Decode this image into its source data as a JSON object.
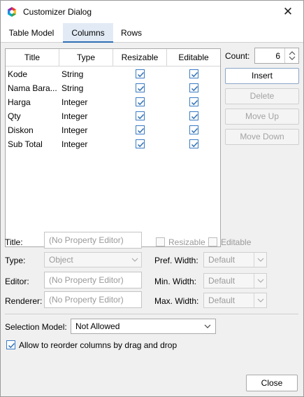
{
  "window": {
    "title": "Customizer Dialog",
    "close_glyph": "✕"
  },
  "tabs": [
    {
      "label": "Table Model",
      "active": false
    },
    {
      "label": "Columns",
      "active": true
    },
    {
      "label": "Rows",
      "active": false
    }
  ],
  "table": {
    "headers": [
      "Title",
      "Type",
      "Resizable",
      "Editable"
    ],
    "rows": [
      {
        "title": "Kode",
        "type": "String",
        "resizable": true,
        "editable": true
      },
      {
        "title": "Nama Bara...",
        "type": "String",
        "resizable": true,
        "editable": true
      },
      {
        "title": "Harga",
        "type": "Integer",
        "resizable": true,
        "editable": true
      },
      {
        "title": "Qty",
        "type": "Integer",
        "resizable": true,
        "editable": true
      },
      {
        "title": "Diskon",
        "type": "Integer",
        "resizable": true,
        "editable": true
      },
      {
        "title": "Sub Total",
        "type": "Integer",
        "resizable": true,
        "editable": true
      }
    ]
  },
  "count": {
    "label": "Count:",
    "value": "6"
  },
  "buttons": {
    "insert": "Insert",
    "delete": "Delete",
    "move_up": "Move Up",
    "move_down": "Move Down",
    "close": "Close"
  },
  "properties": {
    "title_label": "Title:",
    "title_value": "(No Property Editor)",
    "type_label": "Type:",
    "type_value": "Object",
    "editor_label": "Editor:",
    "editor_value": "(No Property Editor)",
    "renderer_label": "Renderer:",
    "renderer_value": "(No Property Editor)",
    "resizable_label": "Resizable",
    "editable_label": "Editable",
    "pref_width_label": "Pref. Width:",
    "pref_width_value": "Default",
    "min_width_label": "Min. Width:",
    "min_width_value": "Default",
    "max_width_label": "Max. Width:",
    "max_width_value": "Default"
  },
  "selection_model": {
    "label": "Selection Model:",
    "value": "Not Allowed"
  },
  "reorder": {
    "label": "Allow to reorder columns by drag and drop",
    "checked": true
  },
  "colors": {
    "accent": "#2f6fb5",
    "check": "#3b7bc4",
    "tab_active_bg": "#e2ebf5"
  },
  "icons": {
    "app": "colorful-hexagon-icon",
    "close": "close-icon",
    "check": "check-icon",
    "spinner": "spinner-arrows-icon",
    "dropdown": "chevron-down-icon"
  }
}
